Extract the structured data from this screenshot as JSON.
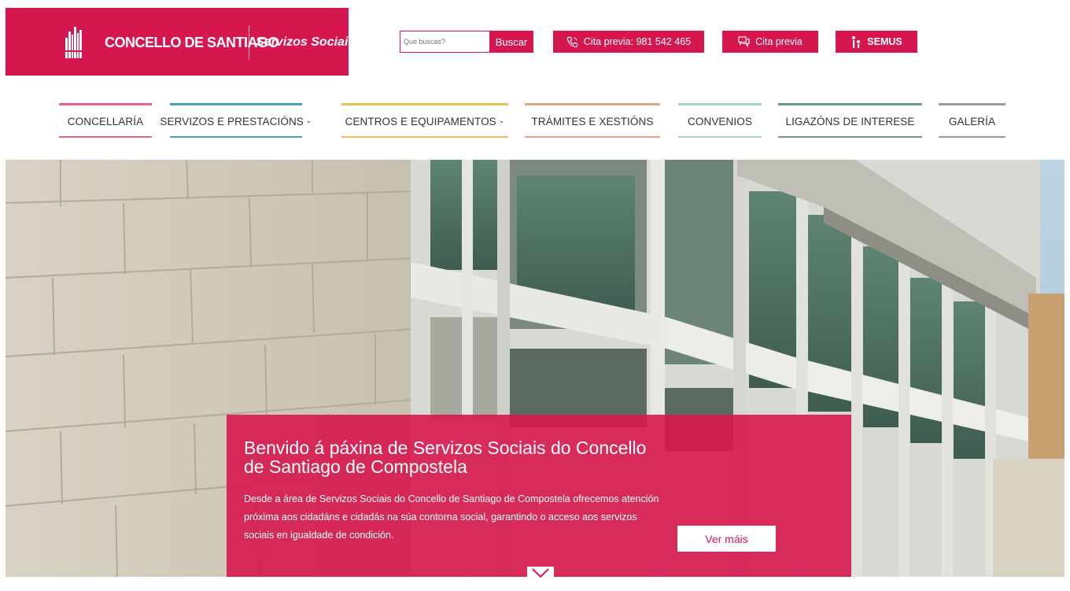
{
  "header": {
    "logo_main": "CONCELLO DE SANTIAGO",
    "logo_sub": "Servizos Sociais",
    "search": {
      "placeholder": "Que buscas?",
      "button_label": "Buscar"
    },
    "buttons": {
      "phone_label": "Cita previa: 981 542 465",
      "cita_label": "Cita previa",
      "semus_label": "SEMUS"
    }
  },
  "nav": {
    "items": [
      {
        "label": "CONCELLARÍA",
        "color": "#e0668c"
      },
      {
        "label": "SERVIZOS E PRESTACIÓNS",
        "color": "#4aa3b0",
        "dropdown": "⌄"
      },
      {
        "label": "CENTROS E EQUIPAMENTOS",
        "color": "#e8c25a",
        "dropdown": "⌄"
      },
      {
        "label": "TRÁMITES E XESTIÓNS",
        "color": "#e8a38c"
      },
      {
        "label": "CONVENIOS",
        "color": "#a9d6cd"
      },
      {
        "label": "LIGAZÓNS DE INTERESE",
        "color": "#6a9a92"
      },
      {
        "label": "GALERÍA",
        "color": "#9a9a9a"
      }
    ]
  },
  "hero": {
    "title": "Benvido á páxina de Servizos Sociais do Concello de Santiago de Compostela",
    "text": "Desde a área de Servizos Sociais do Concello de Santiago de Compostela ofrecemos atención próxima aos cidadáns e cidadás na súa contorna social, garantindo o acceso aos servizos sociais en igualdade de condición.",
    "button_label": "Ver máis"
  },
  "colors": {
    "brand": "#d6174f"
  }
}
